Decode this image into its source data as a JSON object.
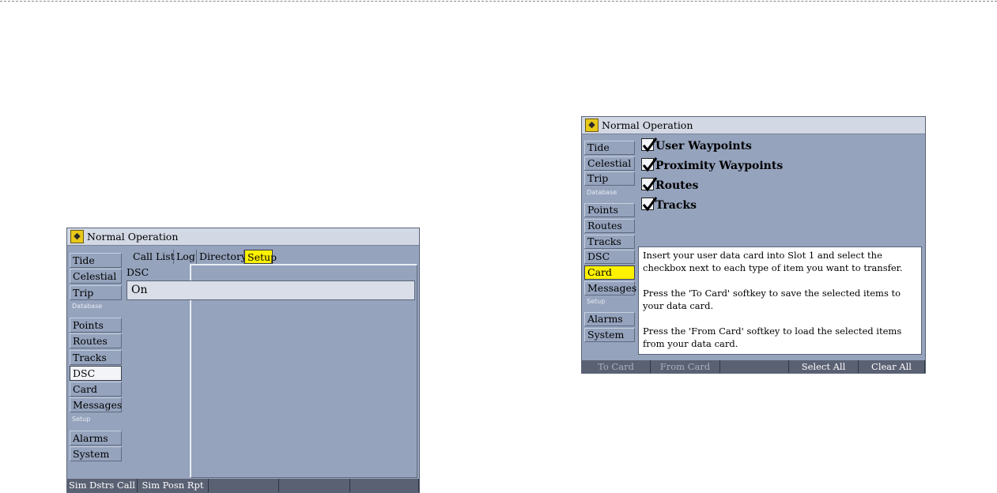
{
  "left_screen": {
    "title": "Normal Operation",
    "sidebar": [
      {
        "label": "Tide"
      },
      {
        "label": "Celestial"
      },
      {
        "label": "Trip"
      },
      {
        "header": "Database"
      },
      {
        "label": "Points"
      },
      {
        "label": "Routes"
      },
      {
        "label": "Tracks"
      },
      {
        "label": "DSC",
        "selected": true
      },
      {
        "label": "Card"
      },
      {
        "label": "Messages"
      },
      {
        "header": "Setup"
      },
      {
        "label": "Alarms"
      },
      {
        "label": "System"
      }
    ],
    "tabs": [
      "Call List",
      "Log",
      "Directory",
      "Setup"
    ],
    "active_tab": "Setup",
    "section_label": "DSC",
    "field_value": "On",
    "softkeys": [
      "Sim Dstrs Call",
      "Sim Posn Rpt",
      "",
      "",
      ""
    ]
  },
  "right_screen": {
    "title": "Normal Operation",
    "sidebar": [
      {
        "label": "Tide"
      },
      {
        "label": "Celestial"
      },
      {
        "label": "Trip"
      },
      {
        "header": "Database"
      },
      {
        "label": "Points"
      },
      {
        "label": "Routes"
      },
      {
        "label": "Tracks"
      },
      {
        "label": "DSC"
      },
      {
        "label": "Card",
        "selected": true
      },
      {
        "label": "Messages"
      },
      {
        "header": "Setup"
      },
      {
        "label": "Alarms"
      },
      {
        "label": "System"
      }
    ],
    "checkboxes": [
      {
        "label": "User Waypoints",
        "checked": true
      },
      {
        "label": "Proximity Waypoints",
        "checked": true
      },
      {
        "label": "Routes",
        "checked": true
      },
      {
        "label": "Tracks",
        "checked": true
      }
    ],
    "info_text": [
      "Insert your user data card into Slot 1 and select the checkbox next to each type of item you want to transfer.",
      "Press the 'To Card' softkey to save the selected items to your data card.",
      "Press the 'From Card' softkey to load the selected items from your data card."
    ],
    "softkeys": [
      {
        "label": "To Card",
        "enabled": false
      },
      {
        "label": "From Card",
        "enabled": false
      },
      {
        "label": "",
        "enabled": false
      },
      {
        "label": "Select All",
        "enabled": true
      },
      {
        "label": "Clear All",
        "enabled": true
      }
    ]
  },
  "colors": {
    "screen_bg": "#95a3bd",
    "highlight_yellow": "#fff200",
    "softkey_bar": "#5a6173",
    "titlebar": "#d2d8e4"
  },
  "icons": {
    "title_icon": "gps-compass-icon",
    "checkbox_mark": "checkmark-icon"
  }
}
